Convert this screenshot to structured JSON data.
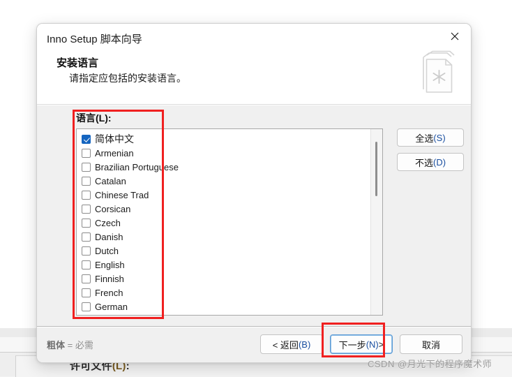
{
  "background": {
    "clipped_label_prefix": "许可文件",
    "clipped_label_accel": "(L)",
    "clipped_label_suffix": ":"
  },
  "dialog": {
    "title": "Inno Setup 脚本向导",
    "close_icon": "close-icon",
    "wizard_icon": "documents-asterisk-icon",
    "header": {
      "heading": "安装语言",
      "subheading": "请指定应包括的安装语言。"
    },
    "body": {
      "list_label": "语言(L):",
      "languages": [
        {
          "name": "简体中文",
          "checked": true,
          "cjk": true
        },
        {
          "name": "Armenian",
          "checked": false,
          "cjk": false
        },
        {
          "name": "Brazilian Portuguese",
          "checked": false,
          "cjk": false
        },
        {
          "name": "Catalan",
          "checked": false,
          "cjk": false
        },
        {
          "name": "Chinese Trad",
          "checked": false,
          "cjk": false
        },
        {
          "name": "Corsican",
          "checked": false,
          "cjk": false
        },
        {
          "name": "Czech",
          "checked": false,
          "cjk": false
        },
        {
          "name": "Danish",
          "checked": false,
          "cjk": false
        },
        {
          "name": "Dutch",
          "checked": false,
          "cjk": false
        },
        {
          "name": "English",
          "checked": false,
          "cjk": false
        },
        {
          "name": "Finnish",
          "checked": false,
          "cjk": false
        },
        {
          "name": "French",
          "checked": false,
          "cjk": false
        },
        {
          "name": "German",
          "checked": false,
          "cjk": false
        }
      ],
      "select_all_label": "全选",
      "select_all_accel": "(S)",
      "select_none_label": "不选",
      "select_none_accel": "(D)"
    },
    "footer": {
      "note_bold": "粗体",
      "note_rest": " = 必需",
      "back_label": "< 返回",
      "back_accel": "(B)",
      "next_label": "下一步",
      "next_accel": "(N)",
      "next_suffix": " >",
      "cancel_label": "取消"
    }
  },
  "annotations": {
    "highlight_color": "#f02020",
    "boxes": [
      {
        "name": "language-list-highlight"
      },
      {
        "name": "next-button-highlight"
      }
    ]
  },
  "watermark": {
    "text": "CSDN @月光下的程序魔术师"
  }
}
